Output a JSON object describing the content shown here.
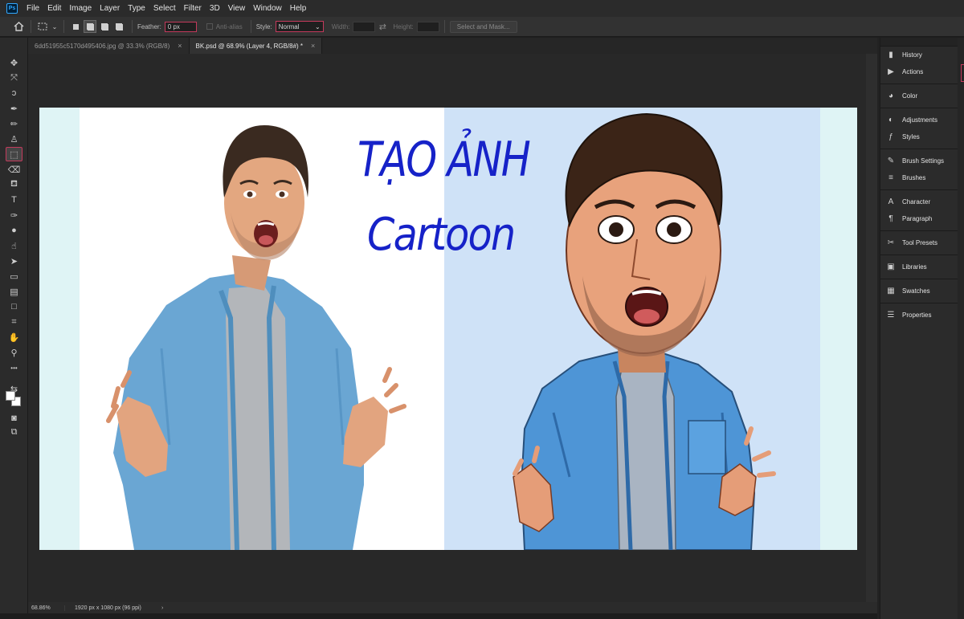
{
  "app": {
    "logo": "Ps"
  },
  "menu": [
    "File",
    "Edit",
    "Image",
    "Layer",
    "Type",
    "Select",
    "Filter",
    "3D",
    "View",
    "Window",
    "Help"
  ],
  "options": {
    "feather_label": "Feather:",
    "feather_value": "0 px",
    "anti_alias_label": "Anti-alias",
    "style_label": "Style:",
    "style_value": "Normal",
    "width_label": "Width:",
    "height_label": "Height:",
    "select_mask_label": "Select and Mask..."
  },
  "tabs": [
    {
      "label": "6dd51955c5170d495406.jpg @ 33.3% (RGB/8)",
      "active": false
    },
    {
      "label": "BK.psd @ 68.9% (Layer 4, RGB/8#) *",
      "active": true
    }
  ],
  "canvas": {
    "title_line1": "TẠO ẢNH",
    "title_line2": "Cartoon",
    "title_color": "#1622c8",
    "left_bg": "#ffffff",
    "right_bg": "#cfe2f7",
    "side_band": "#dff4f5"
  },
  "status": {
    "zoom": "68.86%",
    "dimensions": "1920 px x 1080 px (96 ppi)",
    "arrow": "›"
  },
  "panels": [
    {
      "label": "History",
      "icon": "history-icon",
      "glyph": "▮"
    },
    {
      "label": "Actions",
      "icon": "actions-icon",
      "glyph": "▶"
    },
    {
      "label": "Color",
      "icon": "color-icon",
      "glyph": "◕"
    },
    {
      "label": "Adjustments",
      "icon": "adjustments-icon",
      "glyph": "◐"
    },
    {
      "label": "Styles",
      "icon": "styles-icon",
      "glyph": "ƒ"
    },
    {
      "label": "Brush Settings",
      "icon": "brush-settings-icon",
      "glyph": "✎"
    },
    {
      "label": "Brushes",
      "icon": "brushes-icon",
      "glyph": "≡"
    },
    {
      "label": "Character",
      "icon": "character-icon",
      "glyph": "A"
    },
    {
      "label": "Paragraph",
      "icon": "paragraph-icon",
      "glyph": "¶"
    },
    {
      "label": "Tool Presets",
      "icon": "tool-presets-icon",
      "glyph": "✂"
    },
    {
      "label": "Libraries",
      "icon": "libraries-icon",
      "glyph": "▣"
    },
    {
      "label": "Swatches",
      "icon": "swatches-icon",
      "glyph": "▦"
    },
    {
      "label": "Properties",
      "icon": "properties-icon",
      "glyph": "☰"
    }
  ],
  "tools": [
    {
      "name": "move-tool-icon",
      "glyph": "✥"
    },
    {
      "name": "artboard-tool-icon",
      "glyph": "⤧"
    },
    {
      "name": "lasso-tool-icon",
      "glyph": "ↄ"
    },
    {
      "name": "eyedropper-tool-icon",
      "glyph": "✒"
    },
    {
      "name": "brush-tool-icon",
      "glyph": "✏"
    },
    {
      "name": "stamp-tool-icon",
      "glyph": "♙"
    },
    {
      "name": "marquee-tool-icon",
      "glyph": "⬚"
    },
    {
      "name": "eraser-tool-icon",
      "glyph": "⌫"
    },
    {
      "name": "paint-bucket-tool-icon",
      "glyph": "⛾"
    },
    {
      "name": "type-tool-icon",
      "glyph": "T"
    },
    {
      "name": "pen-tool-icon",
      "glyph": "✑"
    },
    {
      "name": "blur-tool-icon",
      "glyph": "●"
    },
    {
      "name": "smudge-tool-icon",
      "glyph": "☝"
    },
    {
      "name": "path-selection-tool-icon",
      "glyph": "➤"
    },
    {
      "name": "ruler-tool-icon",
      "glyph": "▭"
    },
    {
      "name": "gradient-tool-icon",
      "glyph": "▤"
    },
    {
      "name": "rectangle-tool-icon",
      "glyph": "□"
    },
    {
      "name": "crop-tool-icon",
      "glyph": "⌗"
    },
    {
      "name": "hand-tool-icon",
      "glyph": "✋"
    },
    {
      "name": "zoom-tool-icon",
      "glyph": "⚲"
    },
    {
      "name": "more-tools-icon",
      "glyph": "•••"
    },
    {
      "name": "color-swap-icon",
      "glyph": "⇆"
    },
    {
      "name": "quick-mask-icon",
      "glyph": "◙"
    },
    {
      "name": "screen-mode-icon",
      "glyph": "⧉"
    }
  ]
}
